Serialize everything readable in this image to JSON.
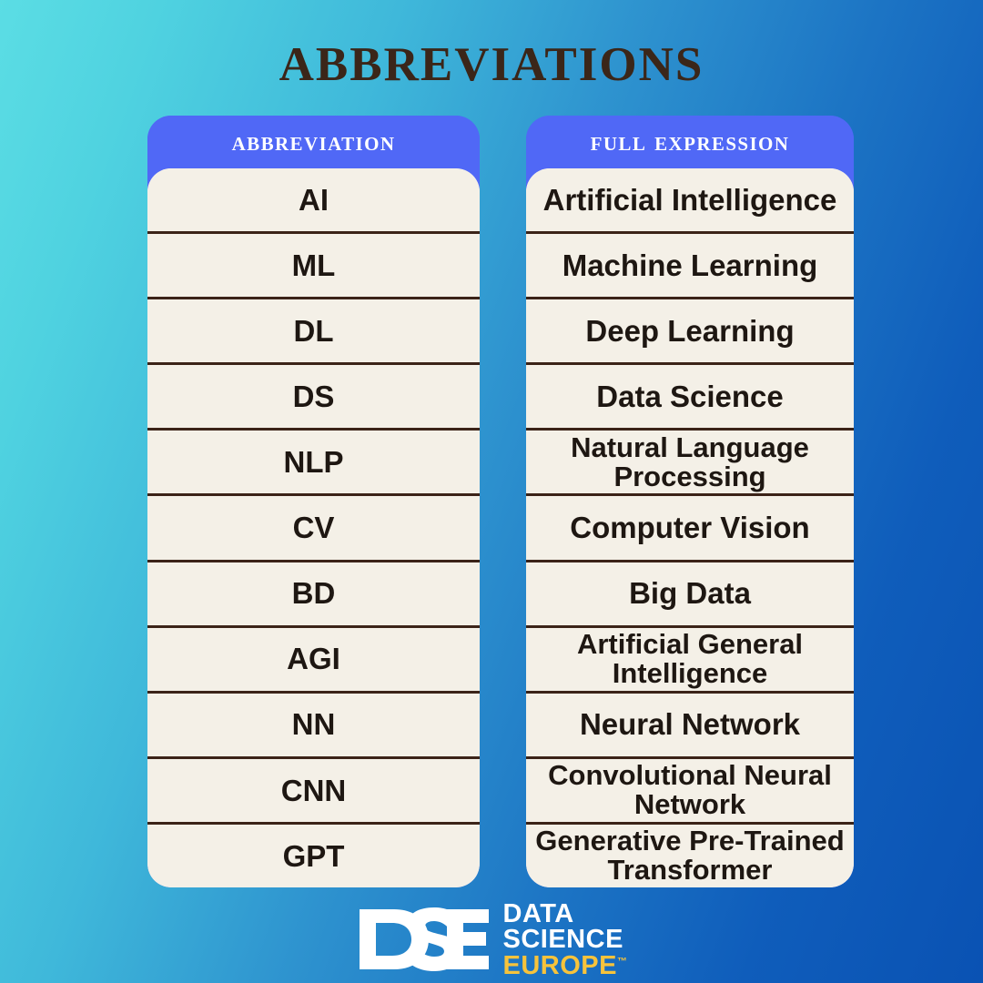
{
  "title": "Abbreviations",
  "table": {
    "headers": {
      "abbreviation": "Abbreviation",
      "full_expression": "Full Expression"
    },
    "rows": [
      {
        "abbr": "AI",
        "full": "Artificial Intelligence"
      },
      {
        "abbr": "ML",
        "full": "Machine Learning"
      },
      {
        "abbr": "DL",
        "full": "Deep Learning"
      },
      {
        "abbr": "DS",
        "full": "Data Science"
      },
      {
        "abbr": "NLP",
        "full": "Natural Language Processing"
      },
      {
        "abbr": "CV",
        "full": "Computer Vision"
      },
      {
        "abbr": "BD",
        "full": "Big Data"
      },
      {
        "abbr": "AGI",
        "full": "Artificial General Intelligence"
      },
      {
        "abbr": "NN",
        "full": "Neural Network"
      },
      {
        "abbr": "CNN",
        "full": "Convolutional Neural Network"
      },
      {
        "abbr": "GPT",
        "full": "Generative Pre-Trained Transformer"
      }
    ]
  },
  "logo": {
    "monogram": "DSE",
    "line1": "DATA",
    "line2": "SCIENCE",
    "line3": "EUROPE",
    "trademark": "™"
  },
  "colors": {
    "background_start": "#5BDDE4",
    "background_end": "#0A52B3",
    "header_blue": "#5068F6",
    "cell_cream": "#F4F0E7",
    "title_brown": "#3B2619",
    "separator_brown": "#3B2318",
    "logo_yellow": "#F6C33C",
    "logo_white": "#FFFFFF"
  }
}
